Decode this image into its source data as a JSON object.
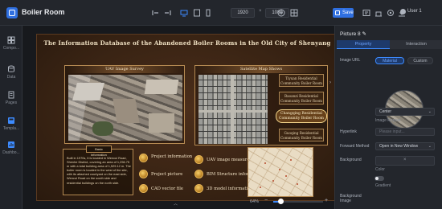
{
  "app": {
    "title": "Boiler Room"
  },
  "toolbar": {
    "width": "1920",
    "height": "1080",
    "save_label": "Save",
    "user_label": "User 1"
  },
  "sidebar": {
    "items": [
      {
        "label": "Compo...",
        "icon": "components-icon",
        "active": false
      },
      {
        "label": "Data",
        "icon": "database-icon",
        "active": false
      },
      {
        "label": "Pages",
        "icon": "pages-icon",
        "active": false
      },
      {
        "label": "Templa...",
        "icon": "template-icon",
        "active": true
      },
      {
        "label": "Dashbo...",
        "icon": "dashboard-icon",
        "active": true
      }
    ]
  },
  "canvas": {
    "title": "The Information Database of the Abandoned Boiler Rooms in the Old City of Shenyang",
    "uav_header": "UAV Image Survey",
    "sat_header": "Satellite Map Shows",
    "sat_items": [
      "Tiyuan Residential Community Boiler Room",
      "Baoanzi Residential Community Boiler Room",
      "Changqing Residential Community Boiler Room",
      "Guoqing Residential Community Boiler Room"
    ],
    "info_tag": "Basic information",
    "info_text": "Built in 1970s, it is located in Wencui Road, Shenhe District, covering an area of 1,256.75 m with a total building area of 1,529.12 m. The boiler room is located in the west of the site, with its attached courtyard on the east side, Wencui Road on the south side and residential buildings on the north side.",
    "buttons_left": [
      "Project information",
      "Project picture",
      "CAD vector file"
    ],
    "buttons_right": [
      "UAV image measurement model",
      "BIM Structure information",
      "3D model information"
    ]
  },
  "zoom": {
    "label": "64%",
    "level": 0.64
  },
  "panel": {
    "title": "Picture 8",
    "tabs": [
      "Property",
      "Interaction"
    ],
    "image_url_label": "Image URL",
    "source_options": [
      "Material",
      "Custom"
    ],
    "position_value": "Center",
    "image_repeat_label": "Image Repeat",
    "hyperlink_label": "Hyperlink",
    "hyperlink_placeholder": "Please input...",
    "forward_method_label": "Forward Method",
    "forward_method_value": "Open in New Window",
    "background_label": "Background",
    "color_label": "Color",
    "gradient_label": "Gradient",
    "background_image_label": "Background Image"
  },
  "colors": {
    "accent": "#3d8bff",
    "gold": "#b58a52",
    "canvas_bg": "#3a2414"
  }
}
